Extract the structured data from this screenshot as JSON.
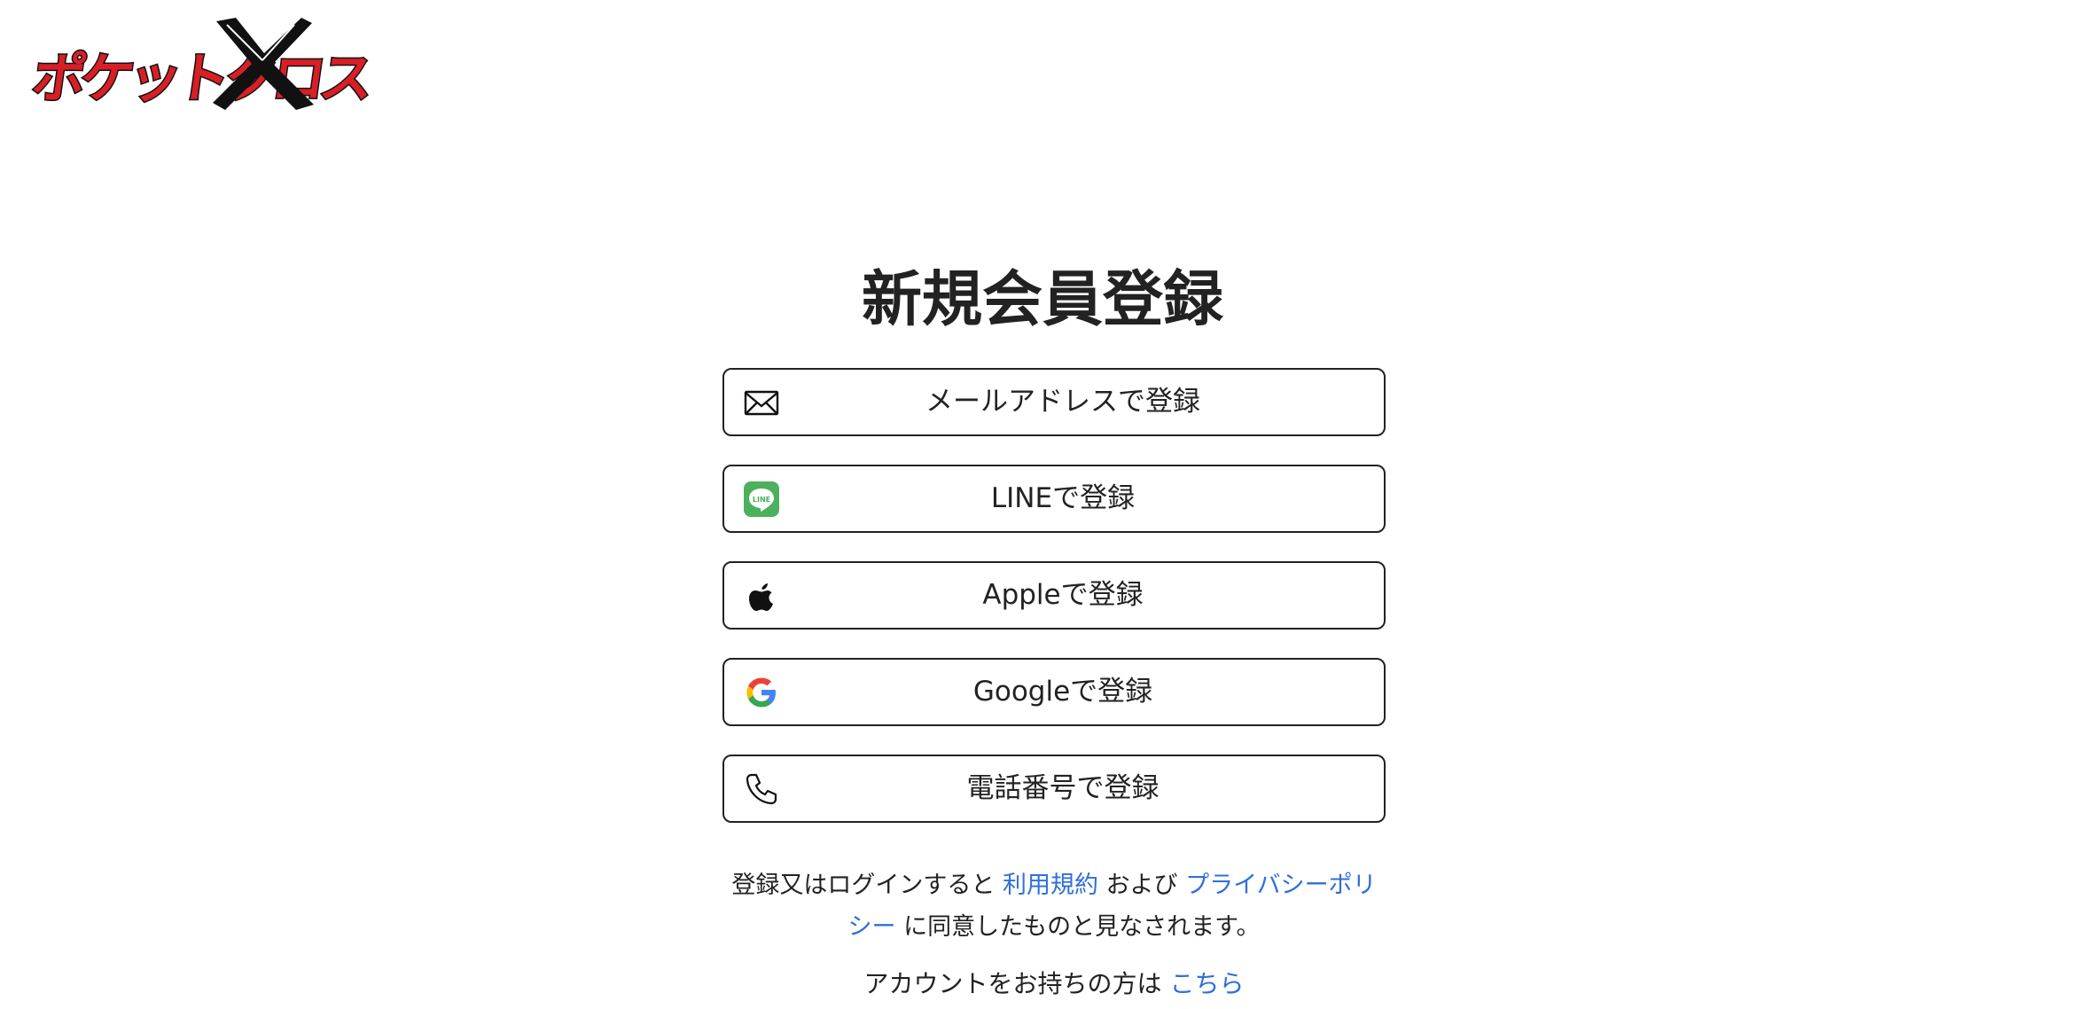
{
  "logo": {
    "text": "ポケットクロス"
  },
  "page": {
    "title": "新規会員登録"
  },
  "buttons": [
    {
      "label": "メールアドレスで登録",
      "icon": "mail-icon"
    },
    {
      "label": "LINEで登録",
      "icon": "line-icon"
    },
    {
      "label": "Appleで登録",
      "icon": "apple-icon"
    },
    {
      "label": "Googleで登録",
      "icon": "google-icon"
    },
    {
      "label": "電話番号で登録",
      "icon": "phone-icon"
    }
  ],
  "terms": {
    "prefix": "登録又はログインすると",
    "terms_link": "利用規約",
    "and": "および",
    "privacy_link": "プライバシーポリシー",
    "suffix": "に同意したものと見なされます。"
  },
  "login": {
    "text": "アカウントをお持ちの方は",
    "link": "こちら"
  },
  "colors": {
    "link": "#2f6fdc",
    "line_green": "#4cb05c",
    "logo_red": "#d81f26",
    "border": "#222222"
  }
}
